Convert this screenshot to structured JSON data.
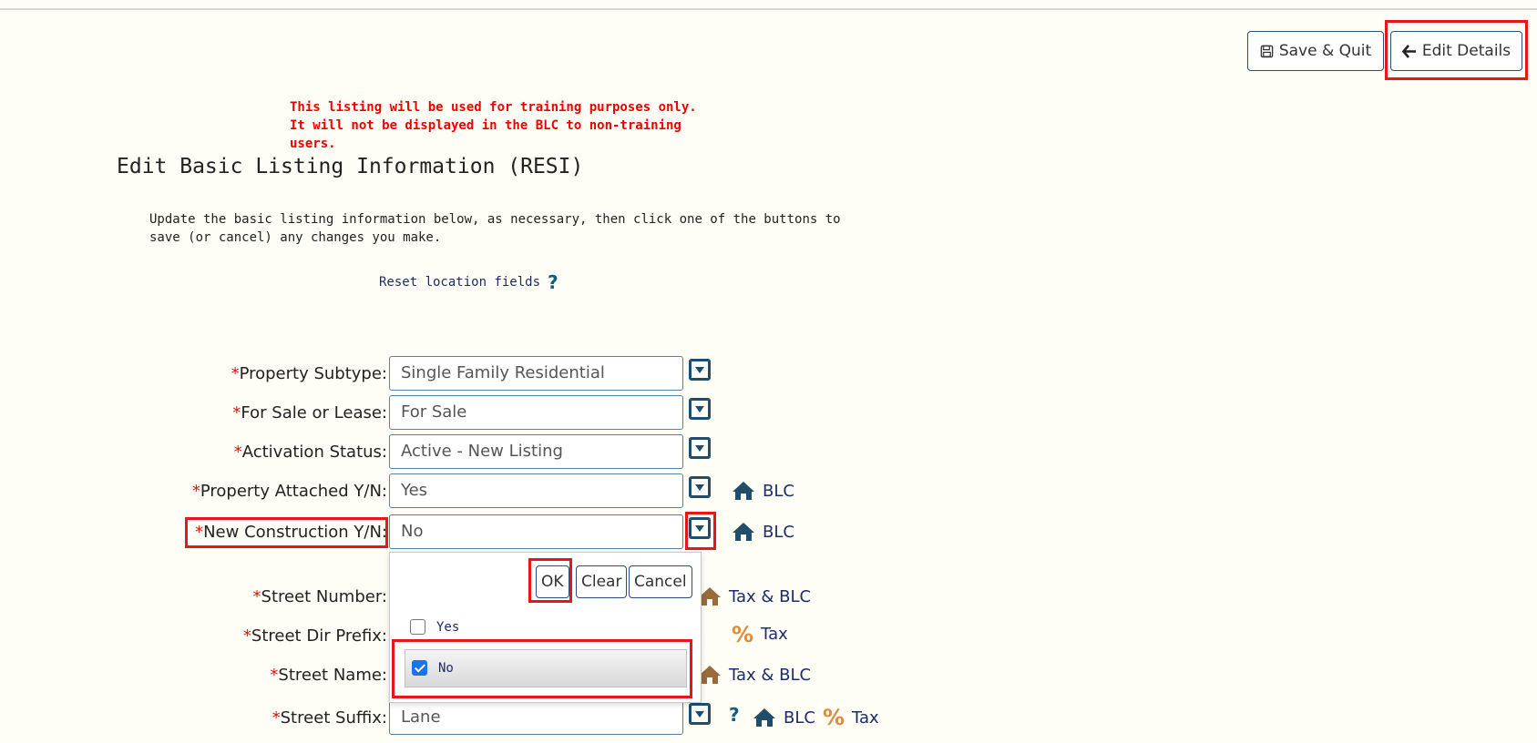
{
  "header": {
    "save_quit_label": "Save & Quit",
    "edit_details_label": "Edit Details"
  },
  "warning_text": "This listing will be used for training purposes only. It will not be displayed in the BLC to non-training users.",
  "page_title": "Edit Basic Listing Information (RESI)",
  "description": "Update the basic listing information below, as necessary, then click one of the buttons to save (or cancel) any changes you make.",
  "reset_link": "Reset location fields",
  "help_glyph": "?",
  "required_mark": "*",
  "fields": [
    {
      "label": "Property Subtype:",
      "value": "Single Family Residential",
      "tag": ""
    },
    {
      "label": "For Sale or Lease:",
      "value": "For Sale",
      "tag": ""
    },
    {
      "label": "Activation Status:",
      "value": "Active - New Listing",
      "tag": ""
    },
    {
      "label": "Property Attached Y/N:",
      "value": "Yes",
      "tag": "BLC"
    },
    {
      "label": "New Construction Y/N:",
      "value": "No",
      "tag": "BLC"
    },
    {
      "label": "Street Number:",
      "value": "",
      "tag": "Tax & BLC"
    },
    {
      "label": "Street Dir Prefix:",
      "value": "",
      "tag": "Tax"
    },
    {
      "label": "Street Name:",
      "value": "",
      "tag": "Tax & BLC"
    },
    {
      "label": "Street Suffix:",
      "value": "Lane",
      "tag_blc": "BLC",
      "tag_tax": "Tax"
    }
  ],
  "popup": {
    "ok_label": "OK",
    "clear_label": "Clear",
    "cancel_label": "Cancel",
    "options": [
      {
        "label": "Yes",
        "checked": false
      },
      {
        "label": "No",
        "checked": true
      }
    ]
  },
  "colors": {
    "accent_red": "#e8151b",
    "link_blue": "#1d2c6b",
    "icon_teal": "#1f4d6b",
    "tax_orange": "#e08a3a"
  },
  "icons": [
    "save-icon",
    "arrow-left-icon",
    "house-icon",
    "percent-icon",
    "help-icon",
    "dropdown-icon"
  ]
}
